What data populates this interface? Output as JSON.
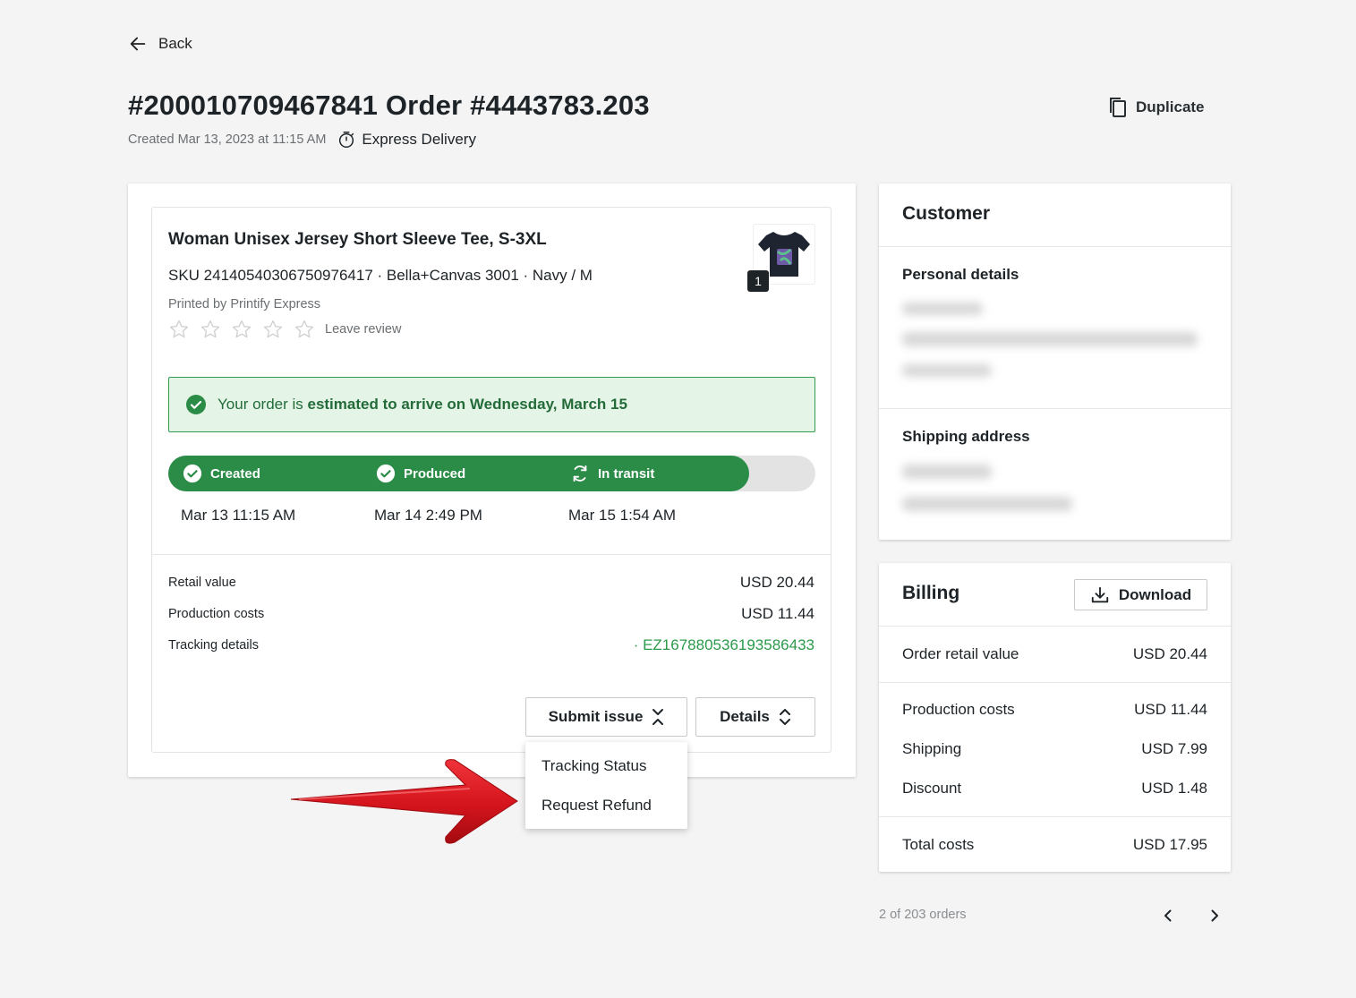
{
  "nav": {
    "back_label": "Back"
  },
  "header": {
    "title": "#200010709467841 Order #4443783.203",
    "created": "Created Mar 13, 2023 at 11:15 AM",
    "delivery": "Express Delivery",
    "duplicate_label": "Duplicate"
  },
  "product": {
    "title": "Woman Unisex Jersey Short Sleeve Tee, S-3XL",
    "sku_line": "SKU 24140540306750976417  · Bella+Canvas 3001 · Navy / M",
    "printed_by": "Printed by Printify Express",
    "leave_review": "Leave review",
    "quantity": "1"
  },
  "estimate": {
    "prefix": "Your order is ",
    "bold": "estimated to arrive on Wednesday, March 15"
  },
  "progress": {
    "fill_fraction": 0.897,
    "steps": [
      {
        "label": "Created",
        "date": "Mar 13 11:15 AM",
        "icon": "check-circle-icon"
      },
      {
        "label": "Produced",
        "date": "Mar 14 2:49 PM",
        "icon": "check-circle-icon"
      },
      {
        "label": "In transit",
        "date": "Mar 15 1:54 AM",
        "icon": "sync-icon"
      }
    ]
  },
  "costs": {
    "retail_label": "Retail value",
    "retail_value": "USD 20.44",
    "production_label": "Production costs",
    "production_value": "USD 11.44",
    "tracking_label": "Tracking details",
    "tracking_value": "· EZ167880536193586433"
  },
  "actions": {
    "submit_issue": "Submit issue",
    "details": "Details",
    "menu": [
      "Tracking Status",
      "Request Refund"
    ]
  },
  "customer": {
    "title": "Customer",
    "personal_details": "Personal details",
    "shipping_address": "Shipping address"
  },
  "billing": {
    "title": "Billing",
    "download": "Download",
    "order_retail_label": "Order retail value",
    "order_retail_value": "USD 20.44",
    "production_label": "Production costs",
    "production_value": "USD 11.44",
    "shipping_label": "Shipping",
    "shipping_value": "USD 7.99",
    "discount_label": "Discount",
    "discount_value": "USD 1.48",
    "total_label": "Total costs",
    "total_value": "USD 17.95"
  },
  "pager": {
    "text": "2 of 203 orders"
  },
  "colors": {
    "accent_green": "#2b8c47",
    "link_green": "#2b9a4a",
    "estimate_bg": "#e4f5e7",
    "annotation_red": "#d4141c"
  }
}
